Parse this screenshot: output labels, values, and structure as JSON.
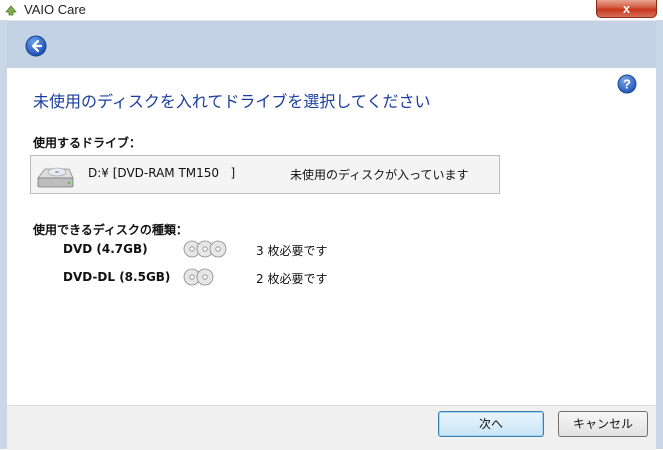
{
  "window": {
    "title": "VAIO Care",
    "close_symbol": "x"
  },
  "main": {
    "heading": "未使用のディスクを入れてドライブを選択してください",
    "drive_section_label": "使用するドライブ：",
    "drive": {
      "name": "D:¥ [DVD-RAM TM150   ]",
      "status": "未使用のディスクが入っています"
    },
    "disc_section_label": "使用できるディスクの種類：",
    "discs": [
      {
        "name": "DVD (4.7GB)",
        "count_text": "3 枚必要です",
        "count": 3
      },
      {
        "name": "DVD-DL (8.5GB)",
        "count_text": "2 枚必要です",
        "count": 2
      }
    ]
  },
  "footer": {
    "next_label": "次へ",
    "cancel_label": "キャンセル"
  },
  "colors": {
    "heading": "#1a3e9e",
    "nav_strip": "#c2d1e3",
    "close_button": "#c7351b"
  },
  "icons": {
    "back": "back-arrow-icon",
    "help": "help-icon",
    "drive": "optical-drive-icon",
    "disc": "disc-icon"
  }
}
